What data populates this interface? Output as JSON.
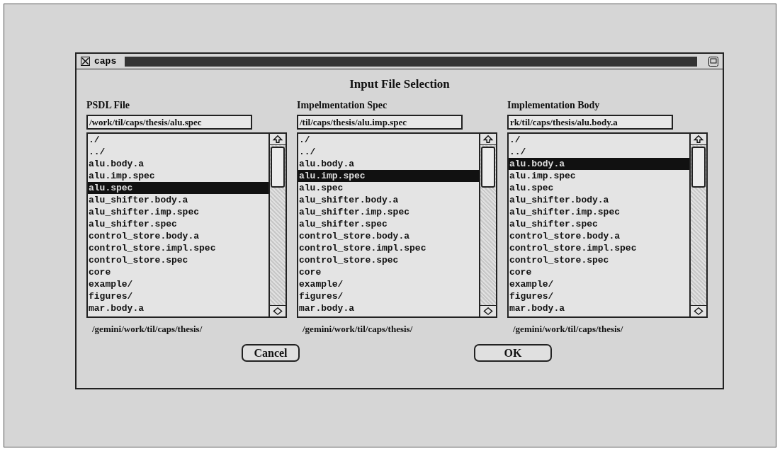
{
  "window": {
    "title": "caps"
  },
  "dialog_title": "Input File Selection",
  "columns": [
    {
      "heading": "PSDL File",
      "field_value": "/work/til/caps/thesis/alu.spec",
      "path": "/gemini/work/til/caps/thesis/",
      "items": [
        {
          "label": "./",
          "selected": false
        },
        {
          "label": "../",
          "selected": false
        },
        {
          "label": "alu.body.a",
          "selected": false
        },
        {
          "label": "alu.imp.spec",
          "selected": false
        },
        {
          "label": "alu.spec",
          "selected": true
        },
        {
          "label": "alu_shifter.body.a",
          "selected": false
        },
        {
          "label": "alu_shifter.imp.spec",
          "selected": false
        },
        {
          "label": "alu_shifter.spec",
          "selected": false
        },
        {
          "label": "control_store.body.a",
          "selected": false
        },
        {
          "label": "control_store.impl.spec",
          "selected": false
        },
        {
          "label": "control_store.spec",
          "selected": false
        },
        {
          "label": "core",
          "selected": false
        },
        {
          "label": "example/",
          "selected": false
        },
        {
          "label": "figures/",
          "selected": false
        },
        {
          "label": "mar.body.a",
          "selected": false
        }
      ]
    },
    {
      "heading": "Impelmentation Spec",
      "field_value": "/til/caps/thesis/alu.imp.spec",
      "path": "/gemini/work/til/caps/thesis/",
      "items": [
        {
          "label": "./",
          "selected": false
        },
        {
          "label": "../",
          "selected": false
        },
        {
          "label": "alu.body.a",
          "selected": false
        },
        {
          "label": "alu.imp.spec",
          "selected": true
        },
        {
          "label": "alu.spec",
          "selected": false
        },
        {
          "label": "alu_shifter.body.a",
          "selected": false
        },
        {
          "label": "alu_shifter.imp.spec",
          "selected": false
        },
        {
          "label": "alu_shifter.spec",
          "selected": false
        },
        {
          "label": "control_store.body.a",
          "selected": false
        },
        {
          "label": "control_store.impl.spec",
          "selected": false
        },
        {
          "label": "control_store.spec",
          "selected": false
        },
        {
          "label": "core",
          "selected": false
        },
        {
          "label": "example/",
          "selected": false
        },
        {
          "label": "figures/",
          "selected": false
        },
        {
          "label": "mar.body.a",
          "selected": false
        }
      ]
    },
    {
      "heading": "Implementation Body",
      "field_value": "rk/til/caps/thesis/alu.body.a",
      "path": "/gemini/work/til/caps/thesis/",
      "items": [
        {
          "label": "./",
          "selected": false
        },
        {
          "label": "../",
          "selected": false
        },
        {
          "label": "alu.body.a",
          "selected": true
        },
        {
          "label": "alu.imp.spec",
          "selected": false
        },
        {
          "label": "alu.spec",
          "selected": false
        },
        {
          "label": "alu_shifter.body.a",
          "selected": false
        },
        {
          "label": "alu_shifter.imp.spec",
          "selected": false
        },
        {
          "label": "alu_shifter.spec",
          "selected": false
        },
        {
          "label": "control_store.body.a",
          "selected": false
        },
        {
          "label": "control_store.impl.spec",
          "selected": false
        },
        {
          "label": "control_store.spec",
          "selected": false
        },
        {
          "label": "core",
          "selected": false
        },
        {
          "label": "example/",
          "selected": false
        },
        {
          "label": "figures/",
          "selected": false
        },
        {
          "label": "mar.body.a",
          "selected": false
        }
      ]
    }
  ],
  "buttons": [
    "Cancel",
    "OK"
  ]
}
